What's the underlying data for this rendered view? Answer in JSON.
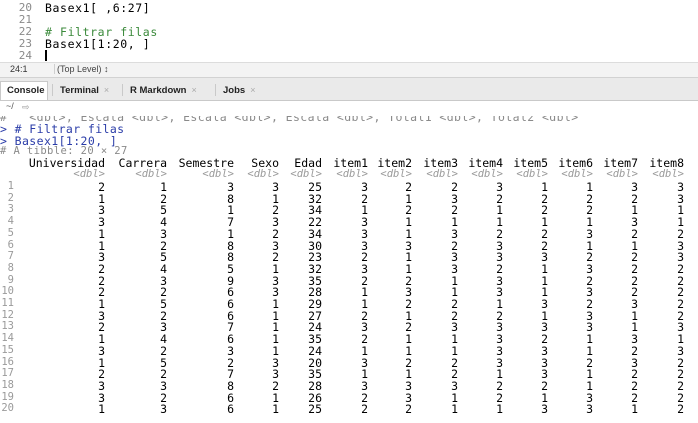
{
  "editor": {
    "lines": [
      {
        "num": "20",
        "code": "Basex1[ ,6:27]",
        "comment": false
      },
      {
        "num": "21",
        "code": "",
        "comment": false
      },
      {
        "num": "22",
        "code": "# Filtrar filas",
        "comment": true
      },
      {
        "num": "23",
        "code": "Basex1[1:20, ]",
        "comment": false
      },
      {
        "num": "24",
        "code": "",
        "comment": false
      }
    ]
  },
  "status": {
    "position": "24:1",
    "scope": "(Top Level) ↕"
  },
  "tabs": [
    {
      "label": "Console",
      "active": true,
      "close": ""
    },
    {
      "label": "Terminal",
      "active": false,
      "close": "×"
    },
    {
      "label": "R Markdown",
      "active": false,
      "close": "×"
    },
    {
      "label": "Jobs",
      "active": false,
      "close": "×"
    }
  ],
  "console_path": "~/",
  "console": {
    "cut_line": "#   <dbl>, Escala <dbl>, Escala <dbl>, Escala <dbl>, Total1 <dbl>, Total2 <dbl>",
    "prompt1": "> # Filtrar filas",
    "prompt2": "> Basex1[1:20, ]",
    "tibble_info": "# A tibble: 20 × 27",
    "columns": [
      "Universidad",
      "Carrera",
      "Semestre",
      "Sexo",
      "Edad",
      "item1",
      "item2",
      "item3",
      "item4",
      "item5",
      "item6",
      "item7",
      "item8"
    ],
    "types": [
      "<dbl>",
      "<dbl>",
      "<dbl>",
      "<dbl>",
      "<dbl>",
      "<dbl>",
      "<dbl>",
      "<dbl>",
      "<dbl>",
      "<dbl>",
      "<dbl>",
      "<dbl>",
      "<dbl>"
    ],
    "rows": [
      [
        "1",
        "2",
        "1",
        "3",
        "3",
        "25",
        "3",
        "2",
        "2",
        "3",
        "1",
        "1",
        "3",
        "3"
      ],
      [
        "2",
        "1",
        "2",
        "8",
        "1",
        "32",
        "2",
        "1",
        "3",
        "2",
        "2",
        "2",
        "2",
        "3"
      ],
      [
        "3",
        "3",
        "5",
        "1",
        "2",
        "34",
        "1",
        "2",
        "2",
        "1",
        "2",
        "2",
        "1",
        "1"
      ],
      [
        "4",
        "3",
        "4",
        "7",
        "3",
        "22",
        "3",
        "1",
        "1",
        "1",
        "1",
        "1",
        "3",
        "1"
      ],
      [
        "5",
        "1",
        "3",
        "1",
        "2",
        "34",
        "3",
        "1",
        "3",
        "2",
        "2",
        "3",
        "2",
        "2"
      ],
      [
        "6",
        "1",
        "2",
        "8",
        "3",
        "30",
        "3",
        "3",
        "2",
        "3",
        "2",
        "1",
        "1",
        "3"
      ],
      [
        "7",
        "3",
        "5",
        "8",
        "2",
        "23",
        "2",
        "1",
        "3",
        "3",
        "3",
        "2",
        "2",
        "3"
      ],
      [
        "8",
        "2",
        "4",
        "5",
        "1",
        "32",
        "3",
        "1",
        "3",
        "2",
        "1",
        "3",
        "2",
        "2"
      ],
      [
        "9",
        "2",
        "3",
        "9",
        "3",
        "35",
        "2",
        "2",
        "1",
        "3",
        "1",
        "2",
        "2",
        "2"
      ],
      [
        "10",
        "2",
        "2",
        "6",
        "3",
        "28",
        "1",
        "3",
        "1",
        "3",
        "1",
        "3",
        "2",
        "2"
      ],
      [
        "11",
        "1",
        "5",
        "6",
        "1",
        "29",
        "1",
        "2",
        "2",
        "1",
        "3",
        "2",
        "3",
        "2"
      ],
      [
        "12",
        "3",
        "2",
        "6",
        "1",
        "27",
        "2",
        "1",
        "2",
        "2",
        "1",
        "3",
        "1",
        "2"
      ],
      [
        "13",
        "2",
        "3",
        "7",
        "1",
        "24",
        "3",
        "2",
        "3",
        "3",
        "3",
        "3",
        "1",
        "3"
      ],
      [
        "14",
        "1",
        "4",
        "6",
        "1",
        "35",
        "2",
        "1",
        "1",
        "3",
        "2",
        "1",
        "3",
        "1"
      ],
      [
        "15",
        "3",
        "2",
        "3",
        "1",
        "24",
        "1",
        "1",
        "1",
        "3",
        "3",
        "1",
        "2",
        "3"
      ],
      [
        "16",
        "1",
        "5",
        "2",
        "3",
        "20",
        "3",
        "2",
        "2",
        "3",
        "3",
        "2",
        "3",
        "2"
      ],
      [
        "17",
        "2",
        "2",
        "7",
        "3",
        "35",
        "1",
        "1",
        "2",
        "1",
        "3",
        "1",
        "2",
        "2"
      ],
      [
        "18",
        "3",
        "3",
        "8",
        "2",
        "28",
        "3",
        "3",
        "3",
        "2",
        "2",
        "1",
        "2",
        "2"
      ],
      [
        "19",
        "3",
        "2",
        "6",
        "1",
        "26",
        "2",
        "3",
        "1",
        "2",
        "1",
        "3",
        "2",
        "2"
      ],
      [
        "20",
        "1",
        "3",
        "6",
        "1",
        "25",
        "2",
        "2",
        "1",
        "1",
        "3",
        "3",
        "1",
        "2"
      ]
    ]
  }
}
